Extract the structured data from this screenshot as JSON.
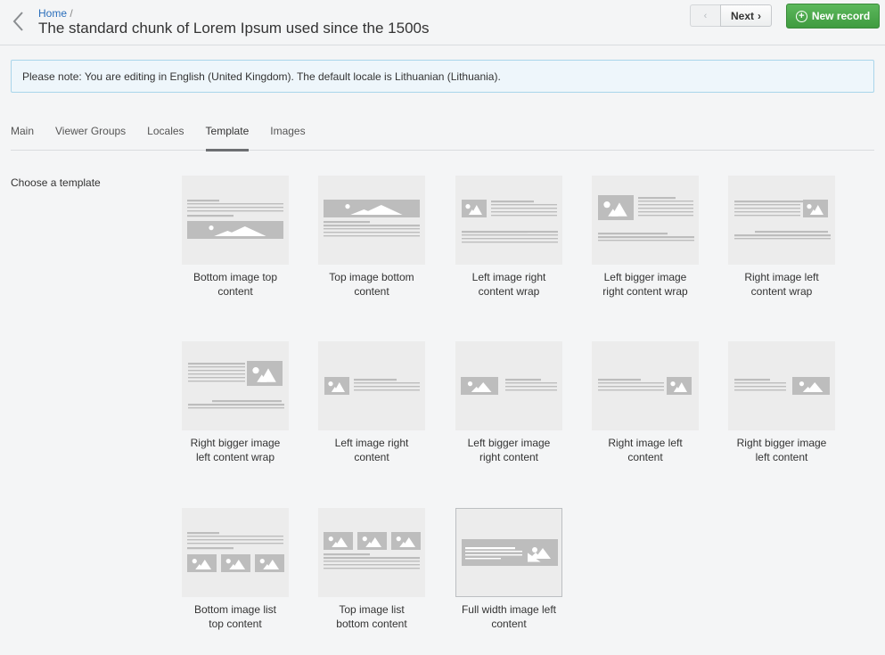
{
  "header": {
    "breadcrumb_home": "Home",
    "breadcrumb_sep": "/",
    "title": "The standard chunk of Lorem Ipsum used since the 1500s",
    "prev_label": "‹",
    "next_label": "Next",
    "next_icon": "›",
    "new_record_label": "New record"
  },
  "notice": "Please note: You are editing in English (United Kingdom). The default locale is Lithuanian (Lithuania).",
  "tabs": [
    "Main",
    "Viewer Groups",
    "Locales",
    "Template",
    "Images"
  ],
  "active_tab": "Template",
  "section_label": "Choose a template",
  "templates": [
    {
      "line1": "Bottom image top",
      "line2": "content"
    },
    {
      "line1": "Top image bottom",
      "line2": "content"
    },
    {
      "line1": "Left image right",
      "line2": "content wrap"
    },
    {
      "line1": "Left bigger image",
      "line2": "right content wrap"
    },
    {
      "line1": "Right image left",
      "line2": "content wrap"
    },
    {
      "line1": "Right bigger image",
      "line2": "left content wrap"
    },
    {
      "line1": "Left image right",
      "line2": "content"
    },
    {
      "line1": "Left bigger image",
      "line2": "right content"
    },
    {
      "line1": "Right image left",
      "line2": "content"
    },
    {
      "line1": "Right bigger image",
      "line2": "left content"
    },
    {
      "line1": "Bottom image list",
      "line2": "top content"
    },
    {
      "line1": "Top image list",
      "line2": "bottom content"
    },
    {
      "line1": "Full width image left",
      "line2": "content"
    }
  ],
  "selected_template": "Full width image left content",
  "colors": {
    "accent_green": "#4cae4c",
    "link_blue": "#2a6ebb",
    "notice_bg": "#eef6fb",
    "thumb_bg": "#ececec",
    "thumb_shape": "#bdbdbd"
  }
}
